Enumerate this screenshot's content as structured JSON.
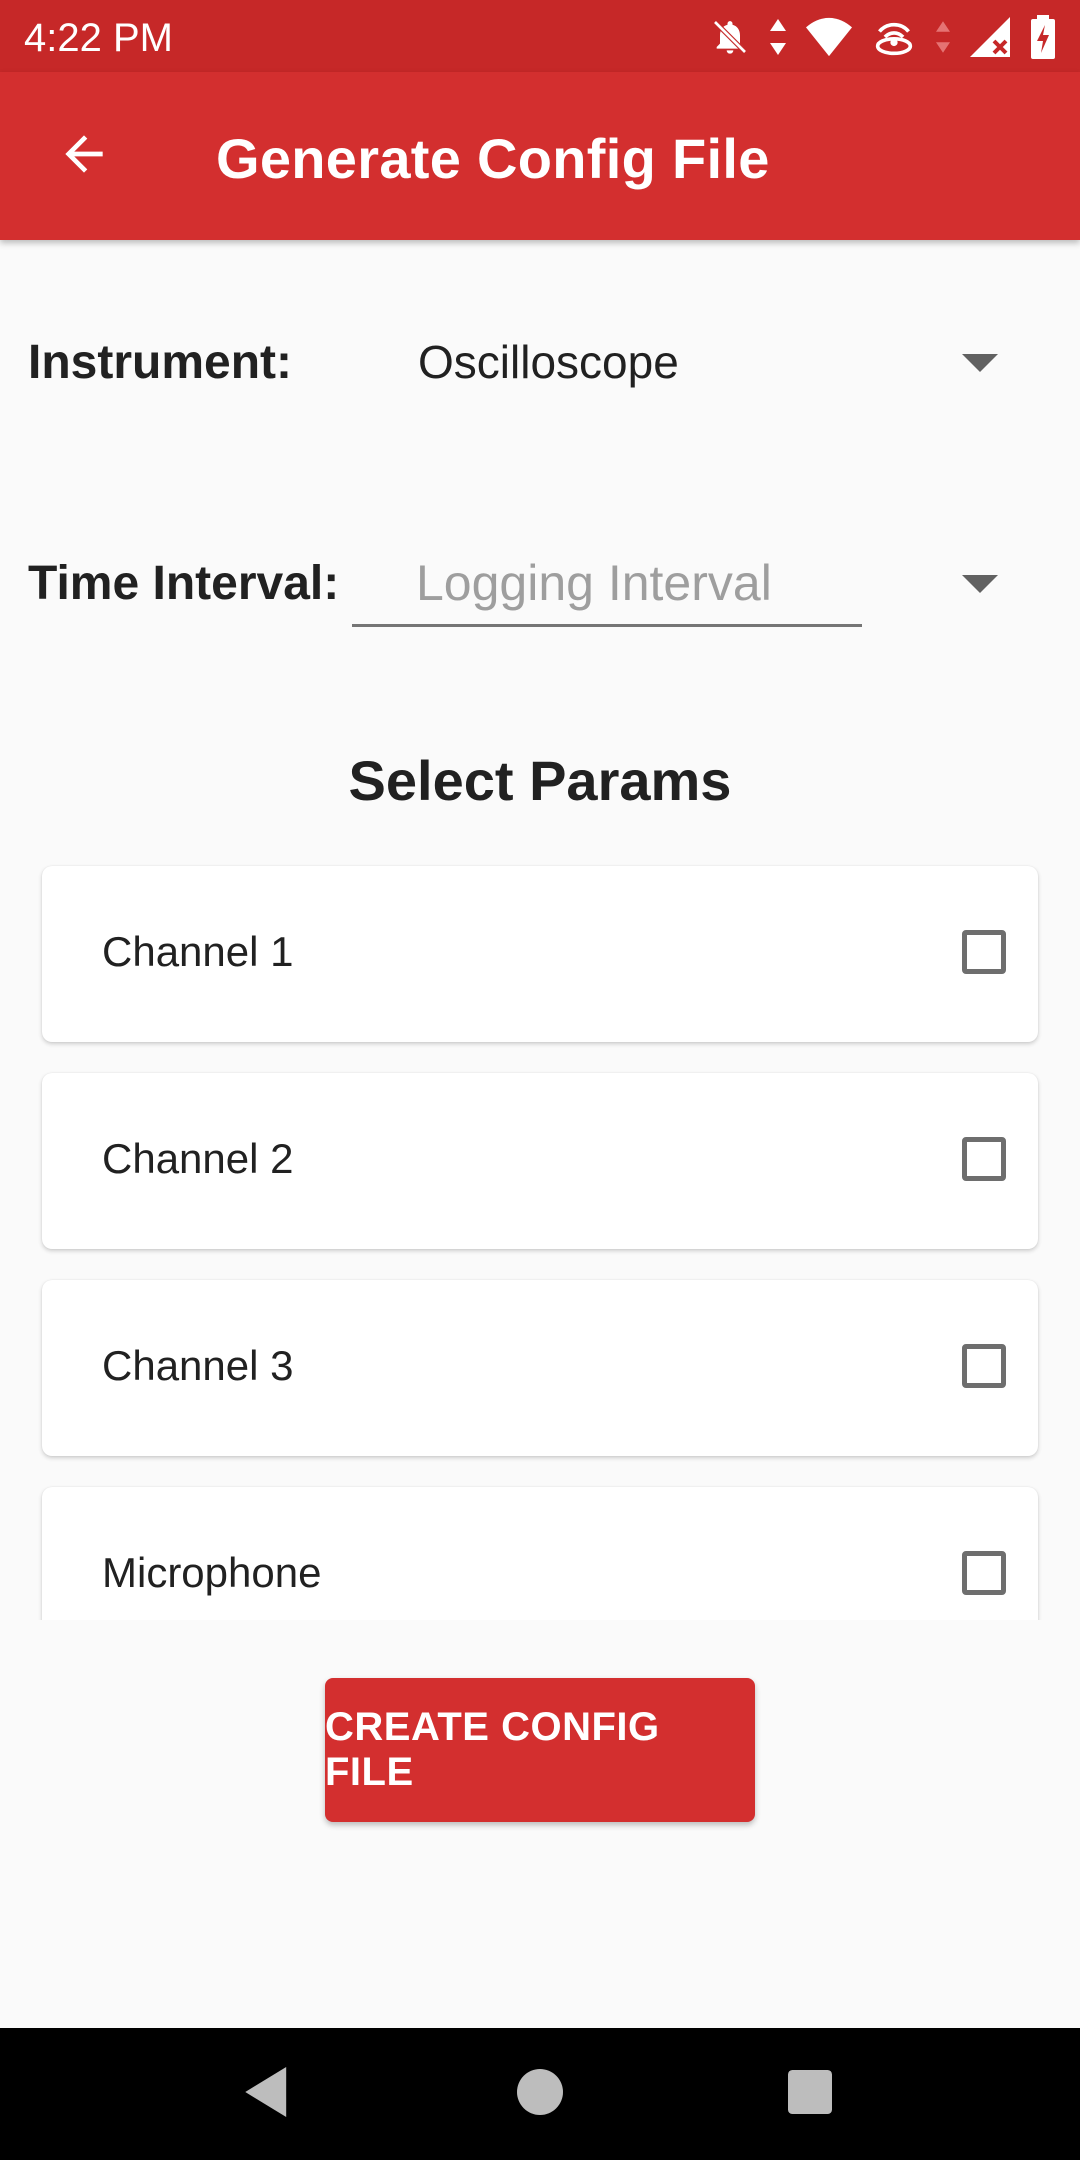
{
  "status_bar": {
    "time": "4:22 PM",
    "icons": [
      "mute-bell-icon",
      "data-arrows-icon",
      "wifi-icon",
      "hotspot-icon",
      "signal-icon",
      "battery-charging-icon"
    ]
  },
  "app_bar": {
    "title": "Generate Config File",
    "back_icon": "arrow-back-icon"
  },
  "form": {
    "instrument_label": "Instrument:",
    "instrument_value": "Oscilloscope",
    "interval_label": "Time Interval:",
    "interval_placeholder": "Logging Interval"
  },
  "params": {
    "title": "Select Params",
    "items": [
      {
        "label": "Channel 1",
        "checked": false
      },
      {
        "label": "Channel 2",
        "checked": false
      },
      {
        "label": "Channel 3",
        "checked": false
      },
      {
        "label": "Microphone",
        "checked": false
      }
    ]
  },
  "create_button": "CREATE CONFIG FILE",
  "colors": {
    "primary": "#D32F2F",
    "primary_dark": "#C62828",
    "background": "#FAFAFA"
  }
}
